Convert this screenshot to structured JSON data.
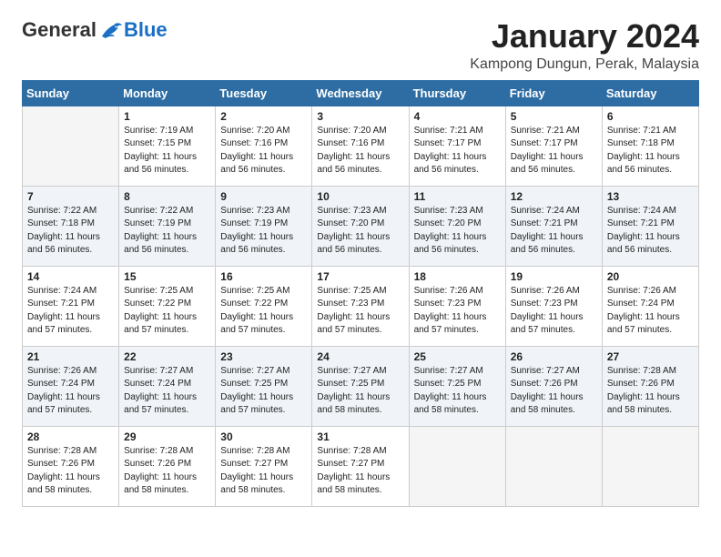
{
  "header": {
    "logo_general": "General",
    "logo_blue": "Blue",
    "month_title": "January 2024",
    "location": "Kampong Dungun, Perak, Malaysia"
  },
  "days_of_week": [
    "Sunday",
    "Monday",
    "Tuesday",
    "Wednesday",
    "Thursday",
    "Friday",
    "Saturday"
  ],
  "weeks": [
    [
      {
        "day": "",
        "info": ""
      },
      {
        "day": "1",
        "info": "Sunrise: 7:19 AM\nSunset: 7:15 PM\nDaylight: 11 hours\nand 56 minutes."
      },
      {
        "day": "2",
        "info": "Sunrise: 7:20 AM\nSunset: 7:16 PM\nDaylight: 11 hours\nand 56 minutes."
      },
      {
        "day": "3",
        "info": "Sunrise: 7:20 AM\nSunset: 7:16 PM\nDaylight: 11 hours\nand 56 minutes."
      },
      {
        "day": "4",
        "info": "Sunrise: 7:21 AM\nSunset: 7:17 PM\nDaylight: 11 hours\nand 56 minutes."
      },
      {
        "day": "5",
        "info": "Sunrise: 7:21 AM\nSunset: 7:17 PM\nDaylight: 11 hours\nand 56 minutes."
      },
      {
        "day": "6",
        "info": "Sunrise: 7:21 AM\nSunset: 7:18 PM\nDaylight: 11 hours\nand 56 minutes."
      }
    ],
    [
      {
        "day": "7",
        "info": "Sunrise: 7:22 AM\nSunset: 7:18 PM\nDaylight: 11 hours\nand 56 minutes."
      },
      {
        "day": "8",
        "info": "Sunrise: 7:22 AM\nSunset: 7:19 PM\nDaylight: 11 hours\nand 56 minutes."
      },
      {
        "day": "9",
        "info": "Sunrise: 7:23 AM\nSunset: 7:19 PM\nDaylight: 11 hours\nand 56 minutes."
      },
      {
        "day": "10",
        "info": "Sunrise: 7:23 AM\nSunset: 7:20 PM\nDaylight: 11 hours\nand 56 minutes."
      },
      {
        "day": "11",
        "info": "Sunrise: 7:23 AM\nSunset: 7:20 PM\nDaylight: 11 hours\nand 56 minutes."
      },
      {
        "day": "12",
        "info": "Sunrise: 7:24 AM\nSunset: 7:21 PM\nDaylight: 11 hours\nand 56 minutes."
      },
      {
        "day": "13",
        "info": "Sunrise: 7:24 AM\nSunset: 7:21 PM\nDaylight: 11 hours\nand 56 minutes."
      }
    ],
    [
      {
        "day": "14",
        "info": "Sunrise: 7:24 AM\nSunset: 7:21 PM\nDaylight: 11 hours\nand 57 minutes."
      },
      {
        "day": "15",
        "info": "Sunrise: 7:25 AM\nSunset: 7:22 PM\nDaylight: 11 hours\nand 57 minutes."
      },
      {
        "day": "16",
        "info": "Sunrise: 7:25 AM\nSunset: 7:22 PM\nDaylight: 11 hours\nand 57 minutes."
      },
      {
        "day": "17",
        "info": "Sunrise: 7:25 AM\nSunset: 7:23 PM\nDaylight: 11 hours\nand 57 minutes."
      },
      {
        "day": "18",
        "info": "Sunrise: 7:26 AM\nSunset: 7:23 PM\nDaylight: 11 hours\nand 57 minutes."
      },
      {
        "day": "19",
        "info": "Sunrise: 7:26 AM\nSunset: 7:23 PM\nDaylight: 11 hours\nand 57 minutes."
      },
      {
        "day": "20",
        "info": "Sunrise: 7:26 AM\nSunset: 7:24 PM\nDaylight: 11 hours\nand 57 minutes."
      }
    ],
    [
      {
        "day": "21",
        "info": "Sunrise: 7:26 AM\nSunset: 7:24 PM\nDaylight: 11 hours\nand 57 minutes."
      },
      {
        "day": "22",
        "info": "Sunrise: 7:27 AM\nSunset: 7:24 PM\nDaylight: 11 hours\nand 57 minutes."
      },
      {
        "day": "23",
        "info": "Sunrise: 7:27 AM\nSunset: 7:25 PM\nDaylight: 11 hours\nand 57 minutes."
      },
      {
        "day": "24",
        "info": "Sunrise: 7:27 AM\nSunset: 7:25 PM\nDaylight: 11 hours\nand 58 minutes."
      },
      {
        "day": "25",
        "info": "Sunrise: 7:27 AM\nSunset: 7:25 PM\nDaylight: 11 hours\nand 58 minutes."
      },
      {
        "day": "26",
        "info": "Sunrise: 7:27 AM\nSunset: 7:26 PM\nDaylight: 11 hours\nand 58 minutes."
      },
      {
        "day": "27",
        "info": "Sunrise: 7:28 AM\nSunset: 7:26 PM\nDaylight: 11 hours\nand 58 minutes."
      }
    ],
    [
      {
        "day": "28",
        "info": "Sunrise: 7:28 AM\nSunset: 7:26 PM\nDaylight: 11 hours\nand 58 minutes."
      },
      {
        "day": "29",
        "info": "Sunrise: 7:28 AM\nSunset: 7:26 PM\nDaylight: 11 hours\nand 58 minutes."
      },
      {
        "day": "30",
        "info": "Sunrise: 7:28 AM\nSunset: 7:27 PM\nDaylight: 11 hours\nand 58 minutes."
      },
      {
        "day": "31",
        "info": "Sunrise: 7:28 AM\nSunset: 7:27 PM\nDaylight: 11 hours\nand 58 minutes."
      },
      {
        "day": "",
        "info": ""
      },
      {
        "day": "",
        "info": ""
      },
      {
        "day": "",
        "info": ""
      }
    ]
  ]
}
